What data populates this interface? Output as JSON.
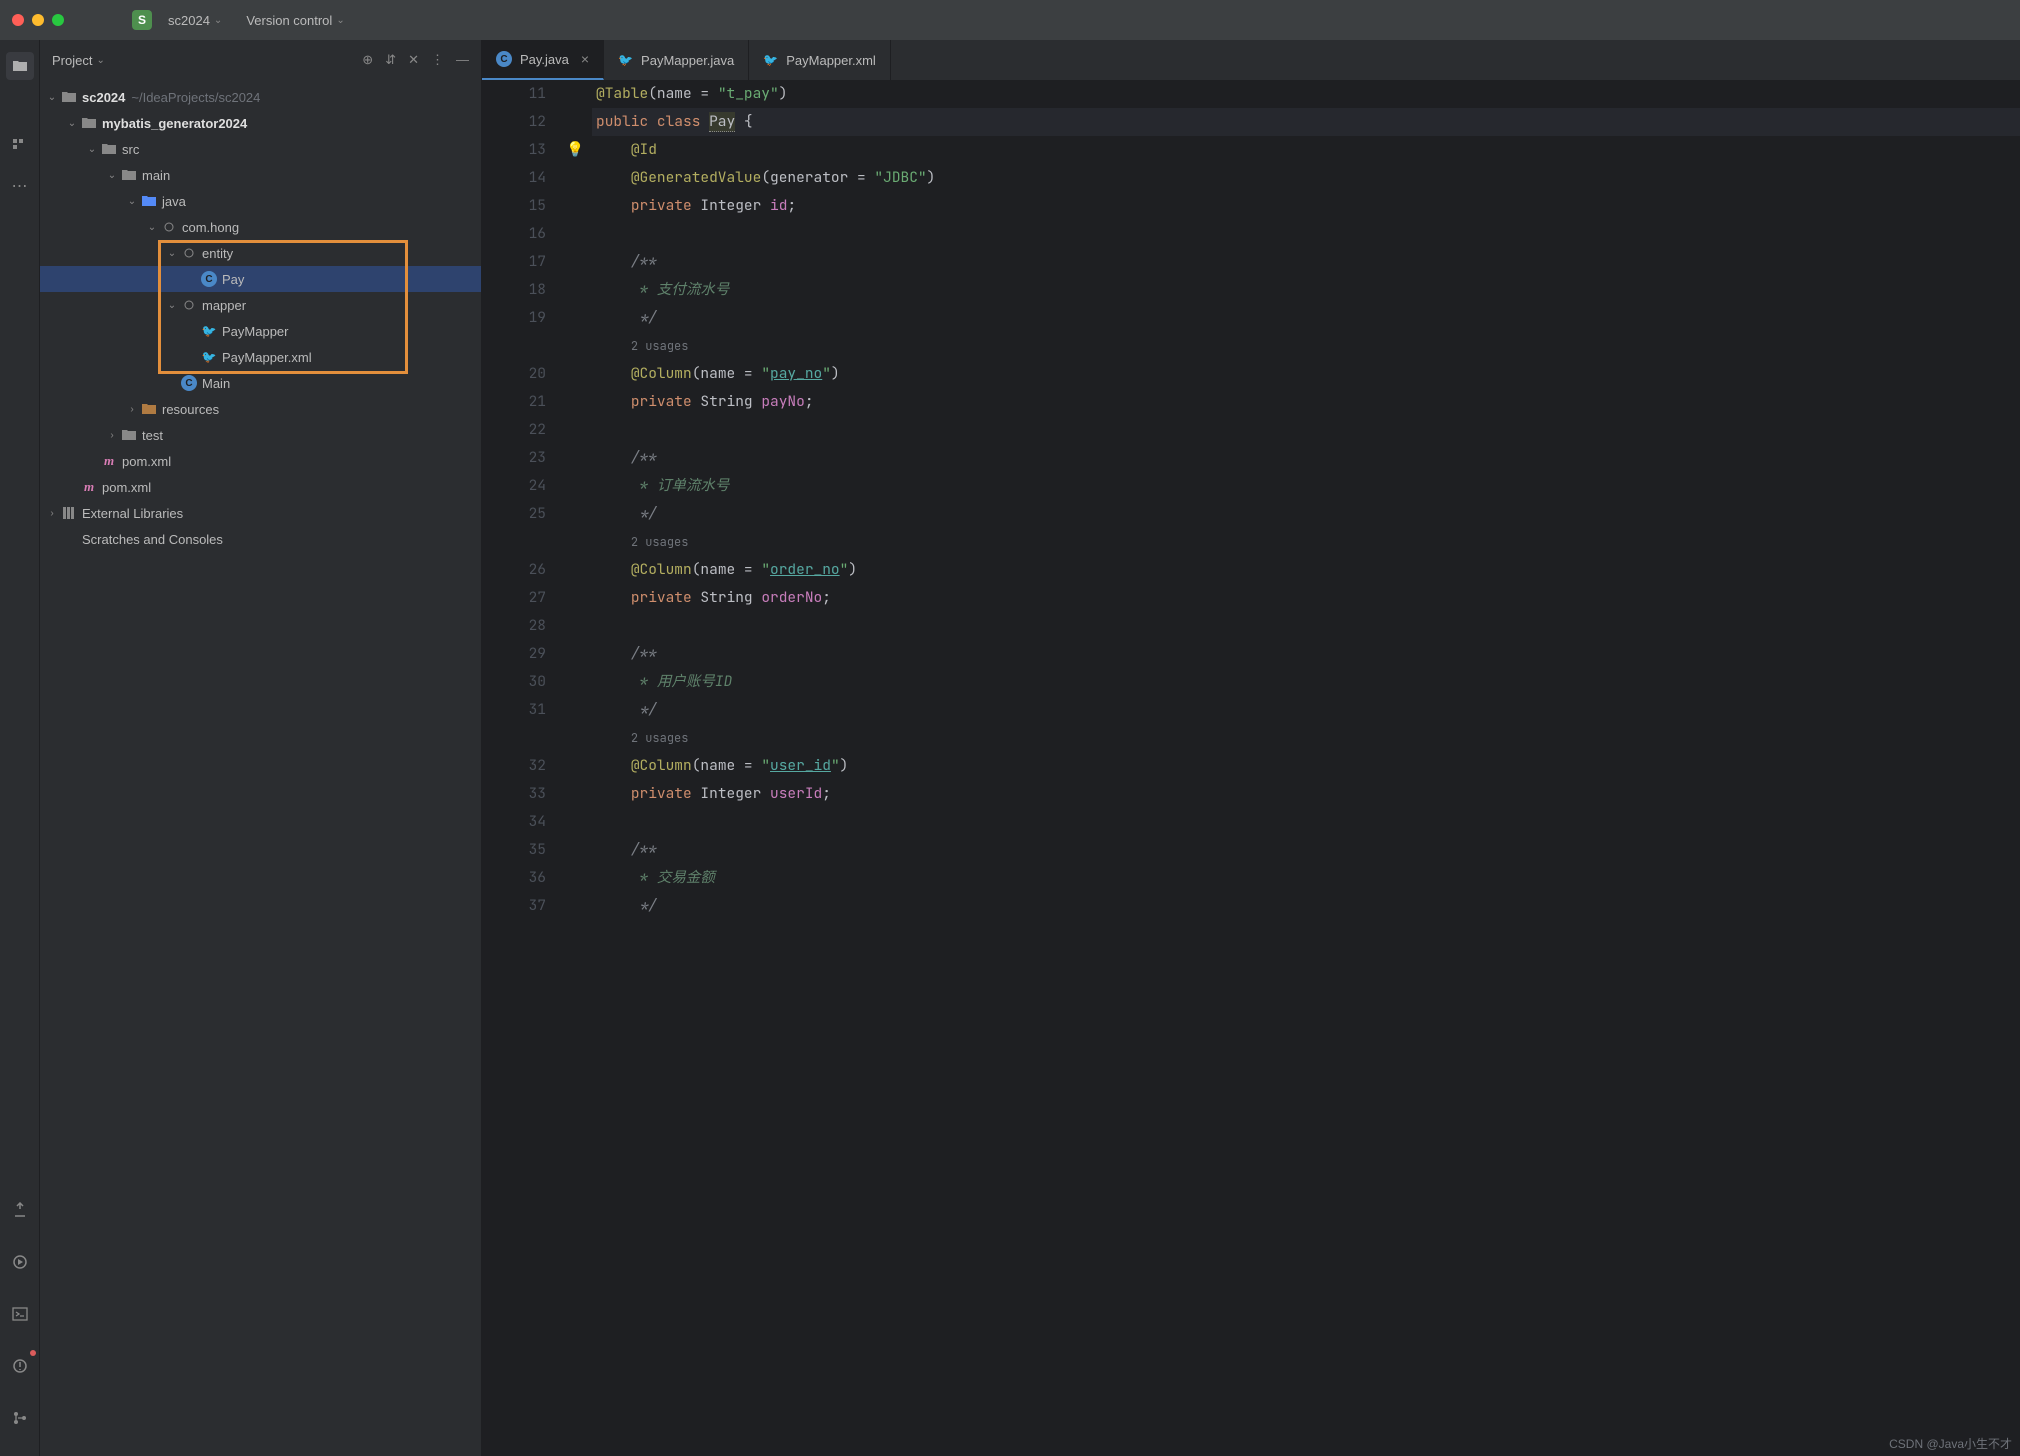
{
  "titlebar": {
    "project_letter": "S",
    "project_name": "sc2024",
    "version_control": "Version control"
  },
  "project_panel": {
    "title": "Project"
  },
  "tree": {
    "root": "sc2024",
    "root_path": "~/IdeaProjects/sc2024",
    "module": "mybatis_generator2024",
    "src": "src",
    "main": "main",
    "java": "java",
    "package": "com.hong",
    "entity_folder": "entity",
    "pay_class": "Pay",
    "mapper_folder": "mapper",
    "pay_mapper": "PayMapper",
    "pay_mapper_xml": "PayMapper.xml",
    "main_class": "Main",
    "resources": "resources",
    "test": "test",
    "pom1": "pom.xml",
    "pom2": "pom.xml",
    "external_libs": "External Libraries",
    "scratches": "Scratches and Consoles"
  },
  "tabs": [
    {
      "label": "Pay.java",
      "icon": "class",
      "active": true,
      "closable": true
    },
    {
      "label": "PayMapper.java",
      "icon": "bird",
      "active": false,
      "closable": false
    },
    {
      "label": "PayMapper.xml",
      "icon": "bird-red",
      "active": false,
      "closable": false
    }
  ],
  "code": {
    "lines": [
      {
        "n": 11,
        "tokens": [
          [
            "@Table",
            "ann"
          ],
          [
            "(",
            "p"
          ],
          [
            "name = ",
            "p"
          ],
          [
            "\"t_pay\"",
            "str"
          ],
          [
            ")",
            "p"
          ]
        ]
      },
      {
        "n": 12,
        "cursor": true,
        "tokens": [
          [
            "public ",
            "kw"
          ],
          [
            "class ",
            "kw"
          ],
          [
            "Pay",
            "class-hl"
          ],
          [
            " {",
            "p"
          ]
        ]
      },
      {
        "n": 13,
        "bulb": true,
        "indent": 1,
        "tokens": [
          [
            "@Id",
            "ann"
          ]
        ]
      },
      {
        "n": 14,
        "indent": 1,
        "tokens": [
          [
            "@GeneratedValue",
            "ann"
          ],
          [
            "(",
            "p"
          ],
          [
            "generator = ",
            "p"
          ],
          [
            "\"JDBC\"",
            "str"
          ],
          [
            ")",
            "p"
          ]
        ]
      },
      {
        "n": 15,
        "indent": 1,
        "tokens": [
          [
            "private ",
            "kw"
          ],
          [
            "Integer ",
            "p"
          ],
          [
            "id",
            "field"
          ],
          [
            ";",
            "p"
          ]
        ]
      },
      {
        "n": 16,
        "tokens": []
      },
      {
        "n": 17,
        "indent": 1,
        "tokens": [
          [
            "/**",
            "cmt"
          ]
        ]
      },
      {
        "n": 18,
        "indent": 1,
        "tokens": [
          [
            " * 支付流水号",
            "cmt-cn"
          ]
        ]
      },
      {
        "n": 19,
        "indent": 1,
        "tokens": [
          [
            " */",
            "cmt"
          ]
        ]
      },
      {
        "n": "",
        "indent": 1,
        "hint": "2 usages"
      },
      {
        "n": 20,
        "indent": 1,
        "tokens": [
          [
            "@Column",
            "ann"
          ],
          [
            "(",
            "p"
          ],
          [
            "name = ",
            "p"
          ],
          [
            "\"",
            "str"
          ],
          [
            "pay_no",
            "str-link"
          ],
          [
            "\"",
            "str"
          ],
          [
            ")",
            "p"
          ]
        ]
      },
      {
        "n": 21,
        "indent": 1,
        "tokens": [
          [
            "private ",
            "kw"
          ],
          [
            "String ",
            "p"
          ],
          [
            "payNo",
            "field"
          ],
          [
            ";",
            "p"
          ]
        ]
      },
      {
        "n": 22,
        "tokens": []
      },
      {
        "n": 23,
        "indent": 1,
        "tokens": [
          [
            "/**",
            "cmt"
          ]
        ]
      },
      {
        "n": 24,
        "indent": 1,
        "tokens": [
          [
            " * 订单流水号",
            "cmt-cn"
          ]
        ]
      },
      {
        "n": 25,
        "indent": 1,
        "tokens": [
          [
            " */",
            "cmt"
          ]
        ]
      },
      {
        "n": "",
        "indent": 1,
        "hint": "2 usages"
      },
      {
        "n": 26,
        "indent": 1,
        "tokens": [
          [
            "@Column",
            "ann"
          ],
          [
            "(",
            "p"
          ],
          [
            "name = ",
            "p"
          ],
          [
            "\"",
            "str"
          ],
          [
            "order_no",
            "str-link"
          ],
          [
            "\"",
            "str"
          ],
          [
            ")",
            "p"
          ]
        ]
      },
      {
        "n": 27,
        "indent": 1,
        "tokens": [
          [
            "private ",
            "kw"
          ],
          [
            "String ",
            "p"
          ],
          [
            "orderNo",
            "field"
          ],
          [
            ";",
            "p"
          ]
        ]
      },
      {
        "n": 28,
        "tokens": []
      },
      {
        "n": 29,
        "indent": 1,
        "tokens": [
          [
            "/**",
            "cmt"
          ]
        ]
      },
      {
        "n": 30,
        "indent": 1,
        "tokens": [
          [
            " * 用户账号ID",
            "cmt-cn"
          ]
        ]
      },
      {
        "n": 31,
        "indent": 1,
        "tokens": [
          [
            " */",
            "cmt"
          ]
        ]
      },
      {
        "n": "",
        "indent": 1,
        "hint": "2 usages"
      },
      {
        "n": 32,
        "indent": 1,
        "tokens": [
          [
            "@Column",
            "ann"
          ],
          [
            "(",
            "p"
          ],
          [
            "name = ",
            "p"
          ],
          [
            "\"",
            "str"
          ],
          [
            "user_id",
            "str-link"
          ],
          [
            "\"",
            "str"
          ],
          [
            ")",
            "p"
          ]
        ]
      },
      {
        "n": 33,
        "indent": 1,
        "tokens": [
          [
            "private ",
            "kw"
          ],
          [
            "Integer ",
            "p"
          ],
          [
            "userId",
            "field"
          ],
          [
            ";",
            "p"
          ]
        ]
      },
      {
        "n": 34,
        "tokens": []
      },
      {
        "n": 35,
        "indent": 1,
        "tokens": [
          [
            "/**",
            "cmt"
          ]
        ]
      },
      {
        "n": 36,
        "indent": 1,
        "tokens": [
          [
            " * 交易金额",
            "cmt-cn"
          ]
        ]
      },
      {
        "n": 37,
        "indent": 1,
        "tokens": [
          [
            " */",
            "cmt"
          ]
        ]
      }
    ]
  },
  "watermark": "CSDN @Java小生不才"
}
